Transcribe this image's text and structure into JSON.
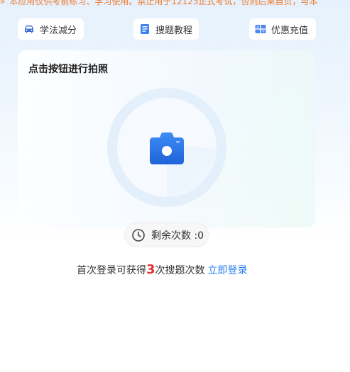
{
  "ticker": {
    "text": "本应用仅供考前练习、学习使用。禁止用于12123正式考试，否则后果自负，与本"
  },
  "nav": {
    "items": [
      {
        "label": "学法减分",
        "icon": "car-icon"
      },
      {
        "label": "搜题教程",
        "icon": "document-icon"
      },
      {
        "label": "优惠充值",
        "icon": "gift-card-icon"
      }
    ]
  },
  "capture": {
    "title": "点击按钮进行拍照",
    "button_icon": "camera-icon"
  },
  "counter": {
    "label": "剩余次数 :0",
    "icon": "clock-icon"
  },
  "login": {
    "prefix": "首次登录可获得",
    "count": "3",
    "suffix": "次搜题次数",
    "link": "立即登录"
  },
  "colors": {
    "accent": "#2a7cf0",
    "warning": "#f07b2b",
    "highlight": "#e8322f"
  }
}
